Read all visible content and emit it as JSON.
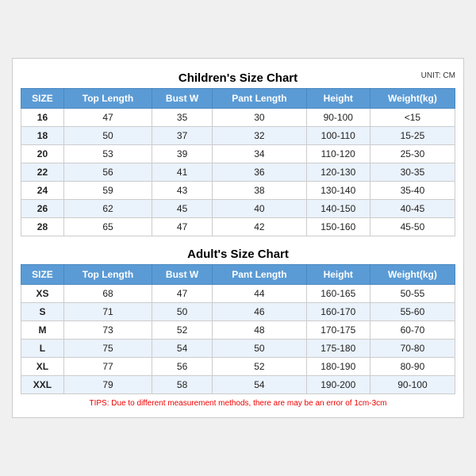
{
  "childrenTitle": "Children's Size Chart",
  "adultTitle": "Adult's Size Chart",
  "unitLabel": "UNIT: CM",
  "headers": [
    "SIZE",
    "Top Length",
    "Bust W",
    "Pant Length",
    "Height",
    "Weight(kg)"
  ],
  "childrenRows": [
    [
      "16",
      "47",
      "35",
      "30",
      "90-100",
      "<15"
    ],
    [
      "18",
      "50",
      "37",
      "32",
      "100-110",
      "15-25"
    ],
    [
      "20",
      "53",
      "39",
      "34",
      "110-120",
      "25-30"
    ],
    [
      "22",
      "56",
      "41",
      "36",
      "120-130",
      "30-35"
    ],
    [
      "24",
      "59",
      "43",
      "38",
      "130-140",
      "35-40"
    ],
    [
      "26",
      "62",
      "45",
      "40",
      "140-150",
      "40-45"
    ],
    [
      "28",
      "65",
      "47",
      "42",
      "150-160",
      "45-50"
    ]
  ],
  "adultRows": [
    [
      "XS",
      "68",
      "47",
      "44",
      "160-165",
      "50-55"
    ],
    [
      "S",
      "71",
      "50",
      "46",
      "160-170",
      "55-60"
    ],
    [
      "M",
      "73",
      "52",
      "48",
      "170-175",
      "60-70"
    ],
    [
      "L",
      "75",
      "54",
      "50",
      "175-180",
      "70-80"
    ],
    [
      "XL",
      "77",
      "56",
      "52",
      "180-190",
      "80-90"
    ],
    [
      "XXL",
      "79",
      "58",
      "54",
      "190-200",
      "90-100"
    ]
  ],
  "tips": "TIPS: Due to different measurement methods, there are may be an error of 1cm-3cm"
}
